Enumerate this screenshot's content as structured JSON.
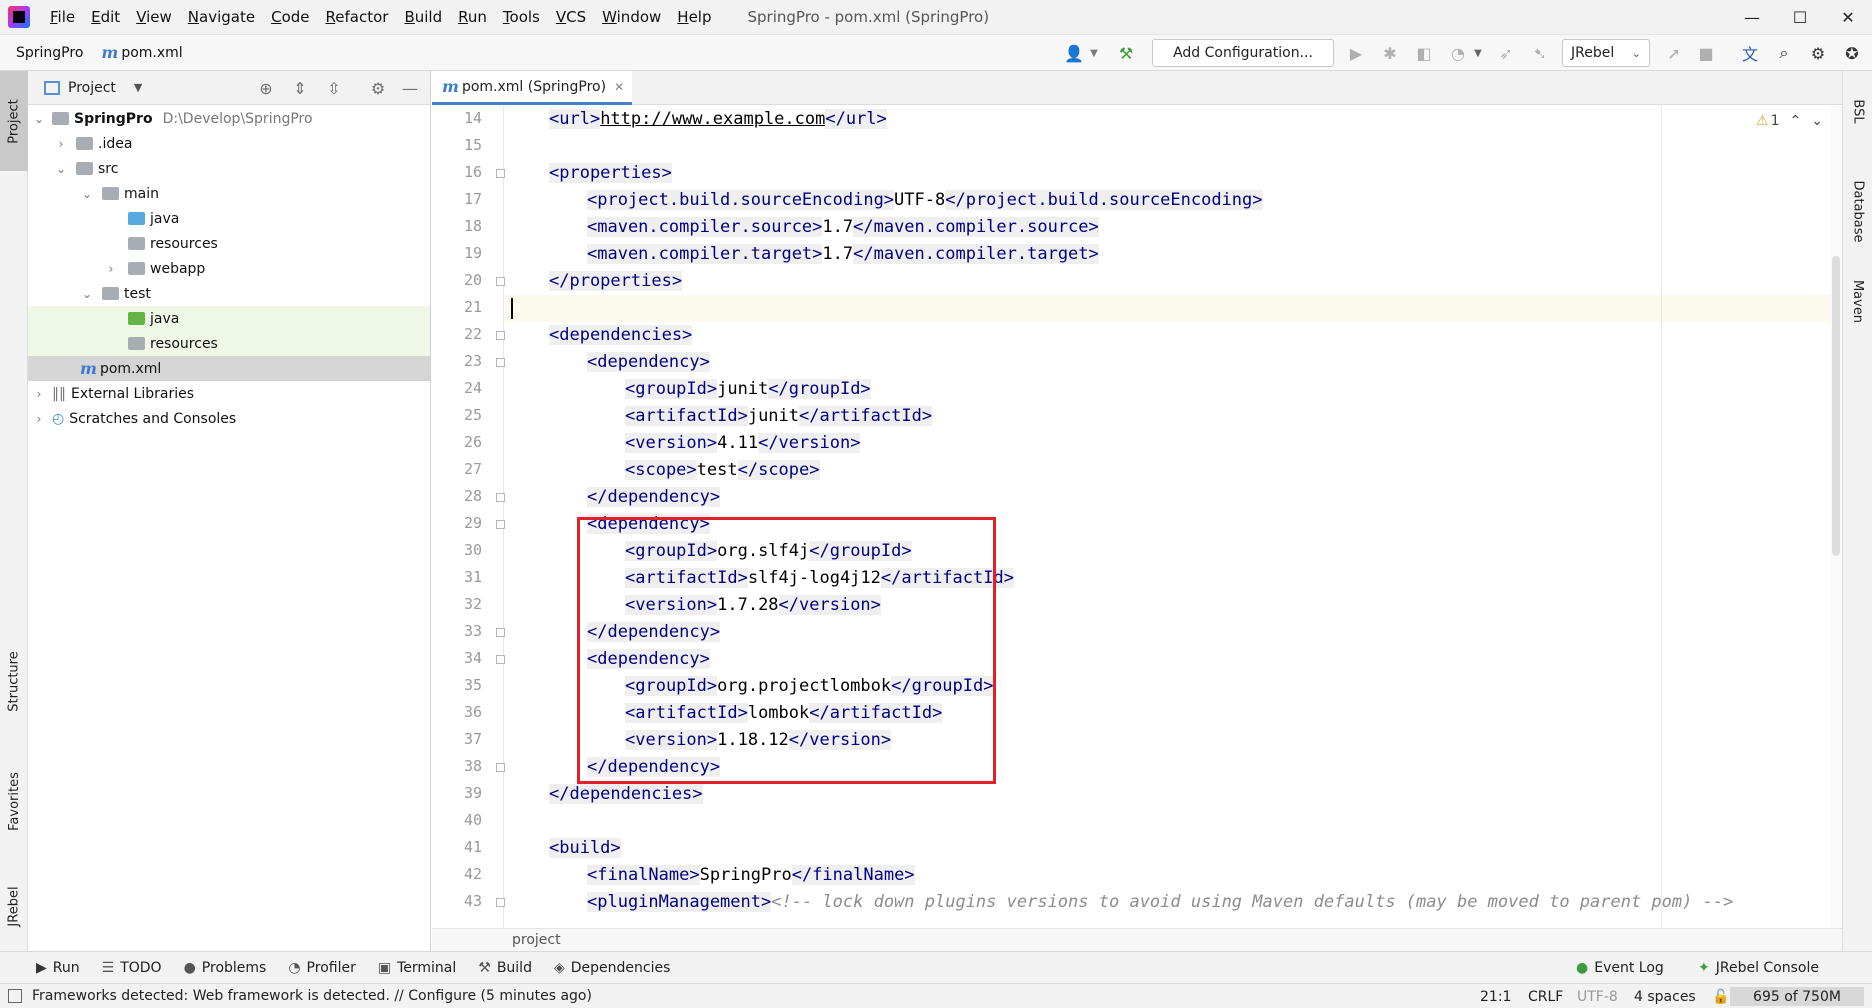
{
  "window": {
    "title": "SpringPro - pom.xml (SpringPro)",
    "menu": [
      "File",
      "Edit",
      "View",
      "Navigate",
      "Code",
      "Refactor",
      "Build",
      "Run",
      "Tools",
      "VCS",
      "Window",
      "Help"
    ],
    "controls": {
      "minimize": "—",
      "maximize": "☐",
      "close": "✕"
    }
  },
  "navbar": {
    "project": "SpringPro",
    "file": "pom.xml",
    "add_config": "Add Configuration...",
    "jrebel": "JRebel"
  },
  "left_strip": {
    "project": "Project",
    "structure": "Structure",
    "favorites": "Favorites",
    "jrebel": "JRebel"
  },
  "right_strip": {
    "bsl": "BSL",
    "database": "Database",
    "maven": "Maven"
  },
  "project_panel": {
    "title": "Project",
    "root": {
      "name": "SpringPro",
      "path": "D:\\Develop\\SpringPro"
    },
    "items": {
      "idea": ".idea",
      "src": "src",
      "main": "main",
      "main_java": "java",
      "main_resources": "resources",
      "webapp": "webapp",
      "test": "test",
      "test_java": "java",
      "test_resources": "resources",
      "pom": "pom.xml",
      "external": "External Libraries",
      "scratches": "Scratches and Consoles"
    }
  },
  "editor": {
    "tab_label": "pom.xml (SpringPro)",
    "warning_count": "1",
    "breadcrumb": "project",
    "line_numbers": [
      "14",
      "15",
      "16",
      "17",
      "18",
      "19",
      "20",
      "21",
      "22",
      "23",
      "24",
      "25",
      "26",
      "27",
      "28",
      "29",
      "30",
      "31",
      "32",
      "33",
      "34",
      "35",
      "36",
      "37",
      "38",
      "39",
      "40",
      "41",
      "42",
      "43"
    ],
    "code": {
      "l14": {
        "o": "<url>",
        "t": "http://www.example.com",
        "c": "</url>"
      },
      "l16": {
        "o": "<properties>"
      },
      "l17": {
        "o": "<project.build.sourceEncoding>",
        "t": "UTF-8",
        "c": "</project.build.sourceEncoding>"
      },
      "l18": {
        "o": "<maven.compiler.source>",
        "t": "1.7",
        "c": "</maven.compiler.source>"
      },
      "l19": {
        "o": "<maven.compiler.target>",
        "t": "1.7",
        "c": "</maven.compiler.target>"
      },
      "l20": {
        "c": "</properties>"
      },
      "l22": {
        "o": "<dependencies>"
      },
      "l23": {
        "o": "<dependency>"
      },
      "l24": {
        "o": "<groupId>",
        "t": "junit",
        "c": "</groupId>"
      },
      "l25": {
        "o": "<artifactId>",
        "t": "junit",
        "c": "</artifactId>"
      },
      "l26": {
        "o": "<version>",
        "t": "4.11",
        "c": "</version>"
      },
      "l27": {
        "o": "<scope>",
        "t": "test",
        "c": "</scope>"
      },
      "l28": {
        "c": "</dependency>"
      },
      "l29": {
        "o": "<dependency>"
      },
      "l30": {
        "o": "<groupId>",
        "t": "org.slf4j",
        "c": "</groupId>"
      },
      "l31": {
        "o": "<artifactId>",
        "t": "slf4j-log4j12",
        "c": "</artifactId>"
      },
      "l32": {
        "o": "<version>",
        "t": "1.7.28",
        "c": "</version>"
      },
      "l33": {
        "c": "</dependency>"
      },
      "l34": {
        "o": "<dependency>"
      },
      "l35": {
        "o": "<groupId>",
        "t": "org.projectlombok",
        "c": "</groupId>"
      },
      "l36": {
        "o": "<artifactId>",
        "t": "lombok",
        "c": "</artifactId>"
      },
      "l37": {
        "o": "<version>",
        "t": "1.18.12",
        "c": "</version>"
      },
      "l38": {
        "c": "</dependency>"
      },
      "l39": {
        "c": "</dependencies>"
      },
      "l41": {
        "o": "<build>"
      },
      "l42": {
        "o": "<finalName>",
        "t": "SpringPro",
        "c": "</finalName>"
      },
      "l43": {
        "o": "<pluginManagement>",
        "cm": "<!-- lock down plugins versions to avoid using Maven defaults (may be moved to parent pom) -->"
      }
    }
  },
  "bottom_tools": {
    "run": "Run",
    "todo": "TODO",
    "problems": "Problems",
    "profiler": "Profiler",
    "terminal": "Terminal",
    "build": "Build",
    "dependencies": "Dependencies",
    "event_log": "Event Log",
    "jrebel_console": "JRebel Console"
  },
  "status": {
    "message": "Frameworks detected: Web framework is detected. // Configure (5 minutes ago)",
    "position": "21:1",
    "line_sep": "CRLF",
    "encoding": "UTF-8",
    "indent": "4 spaces",
    "memory": "695 of 750M"
  }
}
